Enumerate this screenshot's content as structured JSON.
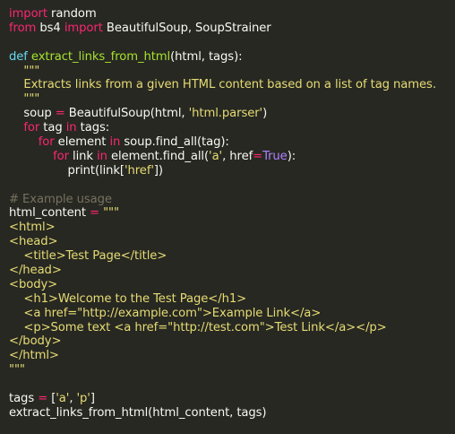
{
  "editor": {
    "language": "python",
    "theme": {
      "background": "#272822",
      "plain": "#f8f8f2",
      "keyword": "#f92672",
      "def_keyword": "#66d9ef",
      "function_name": "#a6e22e",
      "string": "#e6db74",
      "constant": "#ae81ff",
      "comment": "#75715e"
    },
    "lines": [
      [
        {
          "t": "kw",
          "v": "import"
        },
        {
          "t": "plain",
          "v": " random"
        }
      ],
      [
        {
          "t": "kw",
          "v": "from"
        },
        {
          "t": "plain",
          "v": " bs4 "
        },
        {
          "t": "kw",
          "v": "import"
        },
        {
          "t": "plain",
          "v": " BeautifulSoup, SoupStrainer"
        }
      ],
      [],
      [
        {
          "t": "def",
          "v": "def"
        },
        {
          "t": "plain",
          "v": " "
        },
        {
          "t": "fn",
          "v": "extract_links_from_html"
        },
        {
          "t": "plain",
          "v": "(html, tags):"
        }
      ],
      [
        {
          "t": "str",
          "v": "    \"\"\""
        }
      ],
      [
        {
          "t": "str",
          "v": "    Extracts links from a given HTML content based on a list of tag names."
        }
      ],
      [
        {
          "t": "str",
          "v": "    \"\"\""
        }
      ],
      [
        {
          "t": "plain",
          "v": "    soup "
        },
        {
          "t": "op",
          "v": "="
        },
        {
          "t": "plain",
          "v": " BeautifulSoup(html, "
        },
        {
          "t": "str",
          "v": "'html.parser'"
        },
        {
          "t": "plain",
          "v": ")"
        }
      ],
      [
        {
          "t": "plain",
          "v": "    "
        },
        {
          "t": "kw",
          "v": "for"
        },
        {
          "t": "plain",
          "v": " tag "
        },
        {
          "t": "kw",
          "v": "in"
        },
        {
          "t": "plain",
          "v": " tags:"
        }
      ],
      [
        {
          "t": "plain",
          "v": "        "
        },
        {
          "t": "kw",
          "v": "for"
        },
        {
          "t": "plain",
          "v": " element "
        },
        {
          "t": "kw",
          "v": "in"
        },
        {
          "t": "plain",
          "v": " soup.find_all(tag):"
        }
      ],
      [
        {
          "t": "plain",
          "v": "            "
        },
        {
          "t": "kw",
          "v": "for"
        },
        {
          "t": "plain",
          "v": " link "
        },
        {
          "t": "kw",
          "v": "in"
        },
        {
          "t": "plain",
          "v": " element.find_all("
        },
        {
          "t": "str",
          "v": "'a'"
        },
        {
          "t": "plain",
          "v": ", href"
        },
        {
          "t": "op",
          "v": "="
        },
        {
          "t": "const",
          "v": "True"
        },
        {
          "t": "plain",
          "v": "):"
        }
      ],
      [
        {
          "t": "plain",
          "v": "                print(link["
        },
        {
          "t": "str",
          "v": "'href'"
        },
        {
          "t": "plain",
          "v": "])"
        }
      ],
      [],
      [
        {
          "t": "cmt",
          "v": "# Example usage"
        }
      ],
      [
        {
          "t": "plain",
          "v": "html_content "
        },
        {
          "t": "op",
          "v": "="
        },
        {
          "t": "plain",
          "v": " "
        },
        {
          "t": "str",
          "v": "\"\"\""
        }
      ],
      [
        {
          "t": "str",
          "v": "<html>"
        }
      ],
      [
        {
          "t": "str",
          "v": "<head>"
        }
      ],
      [
        {
          "t": "str",
          "v": "    <title>Test Page</title>"
        }
      ],
      [
        {
          "t": "str",
          "v": "</head>"
        }
      ],
      [
        {
          "t": "str",
          "v": "<body>"
        }
      ],
      [
        {
          "t": "str",
          "v": "    <h1>Welcome to the Test Page</h1>"
        }
      ],
      [
        {
          "t": "str",
          "v": "    <a href=\"http://example.com\">Example Link</a>"
        }
      ],
      [
        {
          "t": "str",
          "v": "    <p>Some text <a href=\"http://test.com\">Test Link</a></p>"
        }
      ],
      [
        {
          "t": "str",
          "v": "</body>"
        }
      ],
      [
        {
          "t": "str",
          "v": "</html>"
        }
      ],
      [
        {
          "t": "str",
          "v": "\"\"\""
        }
      ],
      [],
      [
        {
          "t": "plain",
          "v": "tags "
        },
        {
          "t": "op",
          "v": "="
        },
        {
          "t": "plain",
          "v": " ["
        },
        {
          "t": "str",
          "v": "'a'"
        },
        {
          "t": "plain",
          "v": ", "
        },
        {
          "t": "str",
          "v": "'p'"
        },
        {
          "t": "plain",
          "v": "]"
        }
      ],
      [
        {
          "t": "plain",
          "v": "extract_links_from_html(html_content, tags)"
        }
      ]
    ]
  }
}
